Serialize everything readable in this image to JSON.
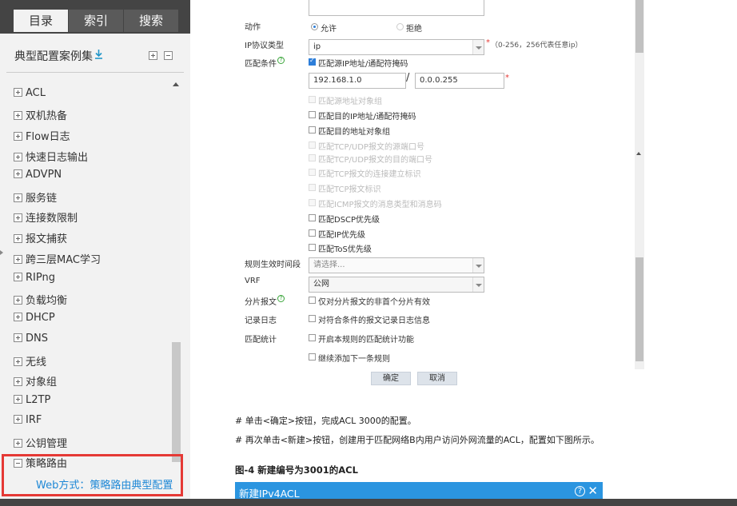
{
  "tabs": [
    "目录",
    "索引",
    "搜索"
  ],
  "sidebar": {
    "title": "典型配置案例集",
    "items": [
      {
        "label": "ACL",
        "state": "plus"
      },
      {
        "label": "双机热备",
        "state": "plus"
      },
      {
        "label": "Flow日志",
        "state": "plus"
      },
      {
        "label": "快速日志输出",
        "state": "plus"
      },
      {
        "label": "ADVPN",
        "state": "plus"
      },
      {
        "label": "服务链",
        "state": "plus"
      },
      {
        "label": "连接数限制",
        "state": "plus"
      },
      {
        "label": "报文捕获",
        "state": "plus"
      },
      {
        "label": "跨三层MAC学习",
        "state": "plus"
      },
      {
        "label": "RIPng",
        "state": "plus"
      },
      {
        "label": "负载均衡",
        "state": "plus"
      },
      {
        "label": "DHCP",
        "state": "plus"
      },
      {
        "label": "DNS",
        "state": "plus"
      },
      {
        "label": "无线",
        "state": "plus"
      },
      {
        "label": "对象组",
        "state": "plus"
      },
      {
        "label": "L2TP",
        "state": "plus"
      },
      {
        "label": "IRF",
        "state": "plus"
      },
      {
        "label": "公钥管理",
        "state": "plus"
      },
      {
        "label": "策略路由",
        "state": "minus"
      }
    ],
    "selected_child": "Web方式：策略路由典型配置"
  },
  "form": {
    "action_label": "动作",
    "action_permit": "允许",
    "action_deny": "拒绝",
    "ip_proto_label": "IP协议类型",
    "ip_proto_value": "ip",
    "ip_proto_hint": "（0-256，256代表任意ip）",
    "match_label": "匹配条件",
    "match_src_ip": "匹配源IP地址/通配符掩码",
    "src_ip": "192.168.1.0",
    "src_wildcard": "0.0.0.255",
    "match_src_obj": "匹配源地址对象组",
    "match_dst_ip": "匹配目的IP地址/通配符掩码",
    "match_dst_obj": "匹配目的地址对象组",
    "match_src_port": "匹配TCP/UDP报文的源端口号",
    "match_dst_port": "匹配TCP/UDP报文的目的端口号",
    "match_tcp_est": "匹配TCP报文的连接建立标识",
    "match_tcp_flag": "匹配TCP报文标识",
    "match_icmp": "匹配ICMP报文的消息类型和消息码",
    "match_dscp": "匹配DSCP优先级",
    "match_ip_prec": "匹配IP优先级",
    "match_tos": "匹配ToS优先级",
    "time_range_label": "规则生效时间段",
    "time_range_placeholder": "请选择...",
    "vrf_label": "VRF",
    "vrf_value": "公网",
    "fragment_label": "分片报文",
    "fragment_option": "仅对分片报文的非首个分片有效",
    "log_label": "记录日志",
    "log_option": "对符合条件的报文记录日志信息",
    "stats_label": "匹配统计",
    "stats_option": "开启本规则的匹配统计功能",
    "continue_option": "继续添加下一条规则",
    "ok_label": "确定",
    "cancel_label": "取消"
  },
  "content": {
    "para1": "# 单击<确定>按钮，完成ACL 3000的配置。",
    "para2": "# 再次单击<新建>按钮，创建用于匹配网络B内用户访问外网流量的ACL，配置如下图所示。",
    "fig_caption": "图-4 新建编号为3001的ACL",
    "dialog_title": "新建IPv4ACL"
  }
}
